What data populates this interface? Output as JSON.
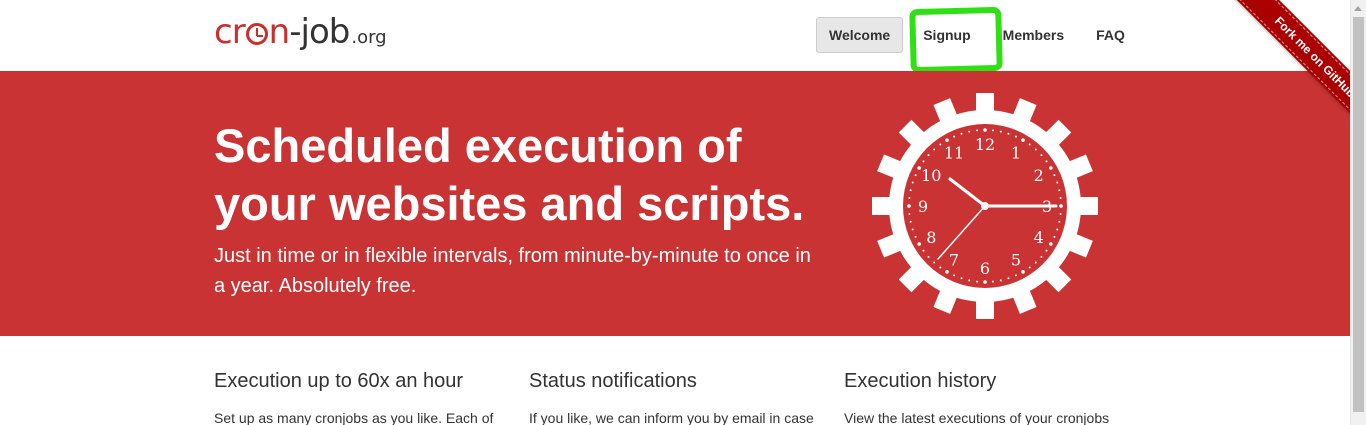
{
  "header": {
    "logo": {
      "prefix": "cr",
      "suffix_letter": "n",
      "job": "-job",
      "tld": ".org"
    },
    "nav": [
      {
        "label": "Welcome",
        "active": true
      },
      {
        "label": "Signup",
        "active": false
      },
      {
        "label": "Members",
        "active": false
      },
      {
        "label": "FAQ",
        "active": false
      }
    ],
    "ribbon": "Fork me on GitHub"
  },
  "hero": {
    "title": "Scheduled execution of your websites and scripts.",
    "subtitle": "Just in time or in flexible intervals, from minute-by-minute to once in a year. Absolutely free.",
    "clock_numbers": [
      "12",
      "1",
      "2",
      "3",
      "4",
      "5",
      "6",
      "7",
      "8",
      "9",
      "10",
      "11"
    ]
  },
  "features": [
    {
      "title": "Execution up to 60x an hour",
      "text": "Set up as many cronjobs as you like. Each of"
    },
    {
      "title": "Status notifications",
      "text": "If you like, we can inform you by email in case"
    },
    {
      "title": "Execution history",
      "text": "View the latest executions of your cronjobs"
    }
  ],
  "colors": {
    "brand_red": "#c93333",
    "highlight_green": "#2fe016",
    "ribbon": "#aa0000"
  }
}
